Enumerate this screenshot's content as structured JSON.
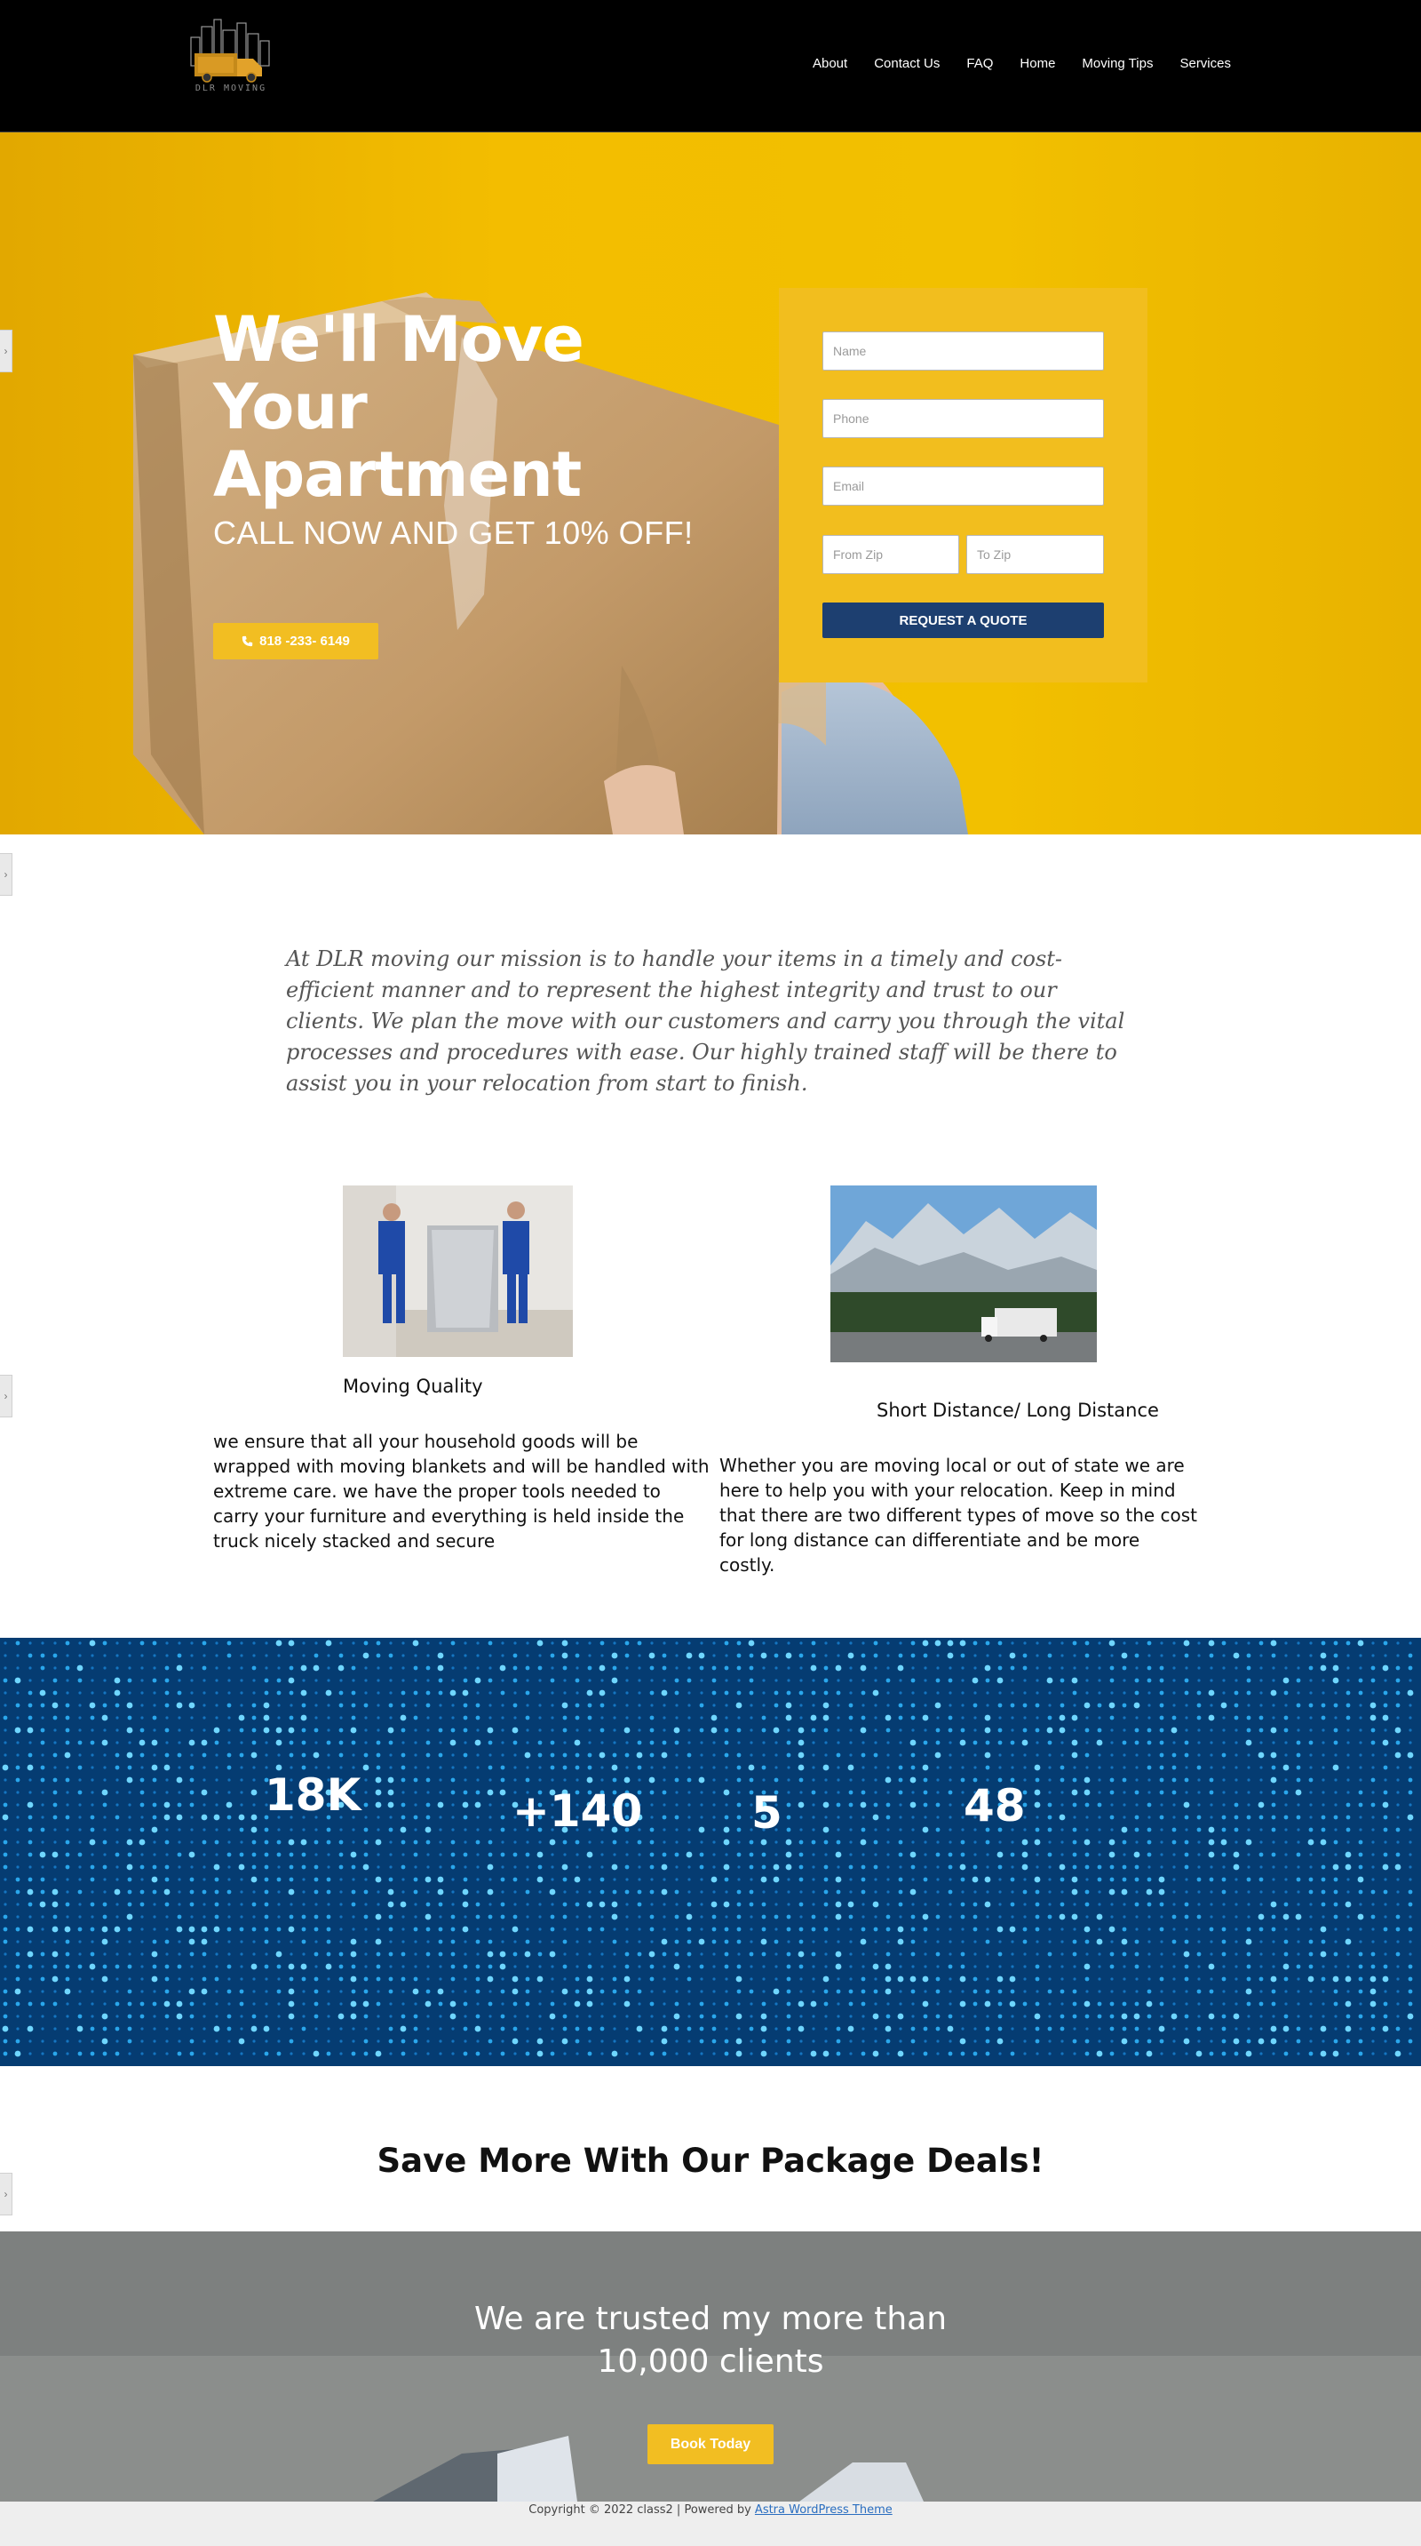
{
  "header": {
    "logo_text": "DLR MOVING",
    "nav": [
      "About",
      "Contact Us",
      "FAQ",
      "Home",
      "Moving Tips",
      "Services"
    ]
  },
  "hero": {
    "title": "We'll Move Your Apartment",
    "subtitle": "CALL NOW AND GET 10% OFF!",
    "phone": "818 -233- 6149",
    "form": {
      "name_placeholder": "Name",
      "phone_placeholder": "Phone",
      "email_placeholder": "Email",
      "from_zip_placeholder": "From Zip",
      "to_zip_placeholder": "To Zip",
      "submit_label": "REQUEST A QUOTE"
    }
  },
  "mission": "At DLR moving our mission is to handle your items in a timely and cost-efficient manner and to represent the highest integrity and trust to our clients. We plan the move with our customers and carry you through the vital processes and procedures with ease. Our highly trained staff will be there to assist you in your relocation from start to finish.",
  "features": [
    {
      "title": "Moving Quality",
      "text": "we ensure that all your household goods will be wrapped with moving blankets and will be handled with extreme care. we have the proper tools needed to carry your furniture and everything is held inside the truck nicely stacked and secure"
    },
    {
      "title": "Short Distance/ Long Distance",
      "text": "Whether you are moving local or out of state we are here to help you with your relocation. Keep in mind that there are two different types of move so the cost for long distance can differentiate and be more costly."
    }
  ],
  "stats": [
    "18K",
    "+140",
    "5",
    "48"
  ],
  "deals": {
    "title": "Save More With Our Package Deals!"
  },
  "trust": {
    "title": "We are trusted my more than 10,000 clients",
    "button": "Book Today"
  },
  "footer": {
    "copyright": "Copyright © 2022 class2 | Powered by ",
    "theme_link": "Astra WordPress Theme"
  },
  "colors": {
    "accent_yellow": "#f2be22",
    "form_button": "#1d3f70",
    "stats_bg": "#053c72"
  }
}
